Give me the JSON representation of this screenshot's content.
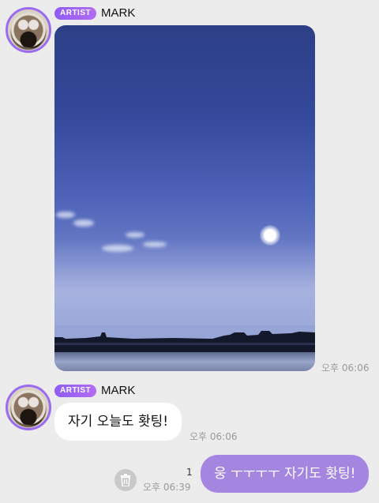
{
  "messages": [
    {
      "badge": "ARTIST",
      "sender": "MARK",
      "time": "오후 06:06"
    },
    {
      "badge": "ARTIST",
      "sender": "MARK",
      "text": "자기 오늘도 홧팅!",
      "time": "오후 06:06"
    }
  ],
  "my_message": {
    "text": "웅 ㅜㅜㅜㅜ 자기도 홧팅!",
    "time": "오후 06:39",
    "unread_count": "1"
  },
  "colors": {
    "background": "#ececec",
    "artist_badge": "#9b6cf0",
    "my_bubble": "#a486e0",
    "time_text": "#9a9a9a"
  },
  "icons": {
    "delete": "trash-icon"
  }
}
